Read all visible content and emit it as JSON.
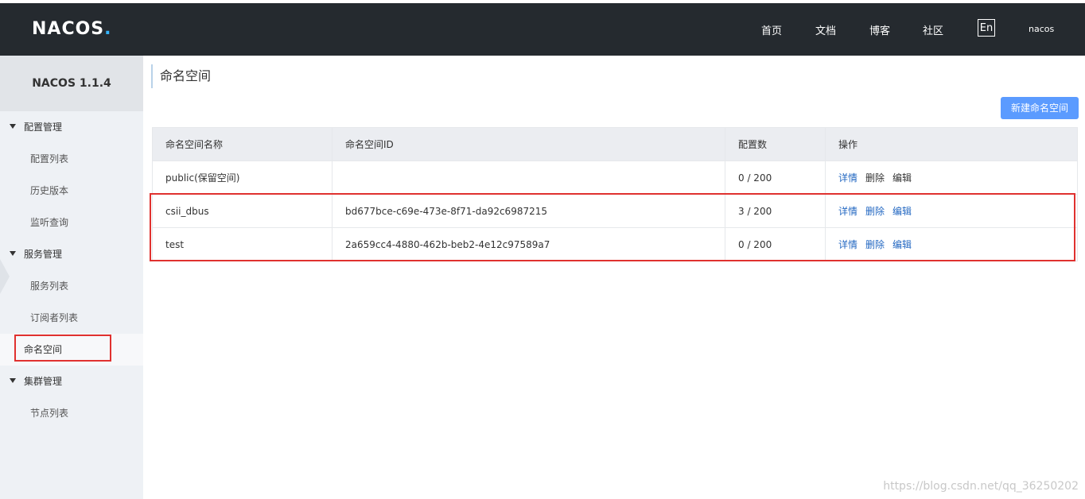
{
  "header": {
    "logo_text": "NACOS",
    "logo_dot": ".",
    "nav": [
      "首页",
      "文档",
      "博客",
      "社区"
    ],
    "lang": "En",
    "user": "nacos"
  },
  "sidebar": {
    "title": "NACOS 1.1.4",
    "groups": [
      {
        "label": "配置管理",
        "items": [
          "配置列表",
          "历史版本",
          "监听查询"
        ]
      },
      {
        "label": "服务管理",
        "items": [
          "服务列表",
          "订阅者列表"
        ]
      },
      {
        "label": "命名空间",
        "items": []
      },
      {
        "label": "集群管理",
        "items": [
          "节点列表"
        ]
      }
    ],
    "active_item": "命名空间"
  },
  "main": {
    "title": "命名空间",
    "new_button": "新建命名空间",
    "table": {
      "headers": [
        "命名空间名称",
        "命名空间ID",
        "配置数",
        "操作"
      ],
      "rows": [
        {
          "name": "public(保留空间)",
          "id": "",
          "count": "0 / 200",
          "ops": [
            "详情",
            "删除",
            "编辑"
          ]
        },
        {
          "name": "csii_dbus",
          "id": "bd677bce-c69e-473e-8f71-da92c6987215",
          "count": "3 / 200",
          "ops": [
            "详情",
            "删除",
            "编辑"
          ]
        },
        {
          "name": "test",
          "id": "2a659cc4-4880-462b-beb2-4e12c97589a7",
          "count": "0 / 200",
          "ops": [
            "详情",
            "删除",
            "编辑"
          ]
        }
      ]
    }
  },
  "watermark": "https://blog.csdn.net/qq_36250202",
  "colors": {
    "topbar": "#252a2f",
    "primary_button": "#5b9bff",
    "link": "#2468c2",
    "annotation": "#e0312f"
  }
}
